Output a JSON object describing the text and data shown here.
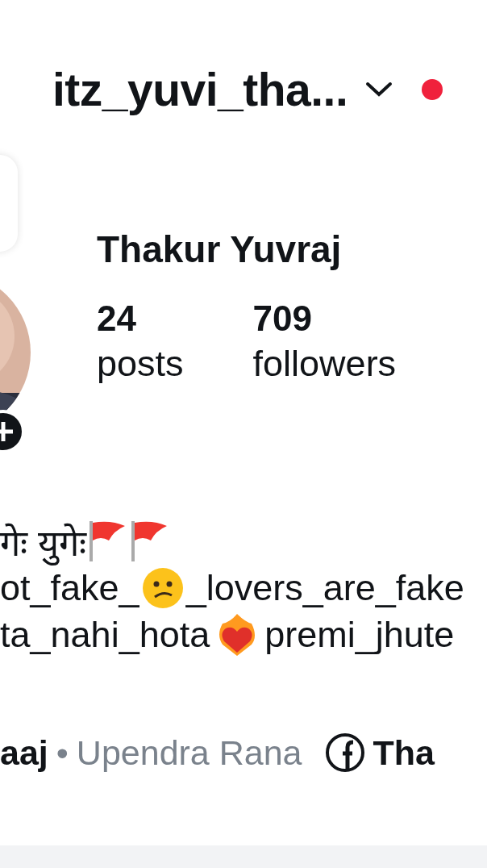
{
  "header": {
    "username": "itz_yuvi_tha...",
    "has_notification": true
  },
  "profile": {
    "has_note": true,
    "name": "Thakur Yuvraj",
    "stats": [
      {
        "value": "24",
        "label": "posts"
      },
      {
        "value": "709",
        "label": "followers"
      }
    ]
  },
  "bio": [
    [
      {
        "kind": "text",
        "text": "गेः युगेः"
      },
      {
        "kind": "flag"
      },
      {
        "kind": "flag"
      }
    ],
    [
      {
        "kind": "text",
        "text": "ot_fake_"
      },
      {
        "kind": "face"
      },
      {
        "kind": "text",
        "text": "_lovers_are_fake"
      }
    ],
    [
      {
        "kind": "text",
        "text": "ta_nahi_hota"
      },
      {
        "kind": "heart"
      },
      {
        "kind": "text",
        "text": "premi_jhute"
      }
    ]
  ],
  "links": {
    "mutual_bold": "aaj",
    "separator": "•",
    "mutual_name": "Upendra Rana",
    "facebook_label": "Tha"
  }
}
